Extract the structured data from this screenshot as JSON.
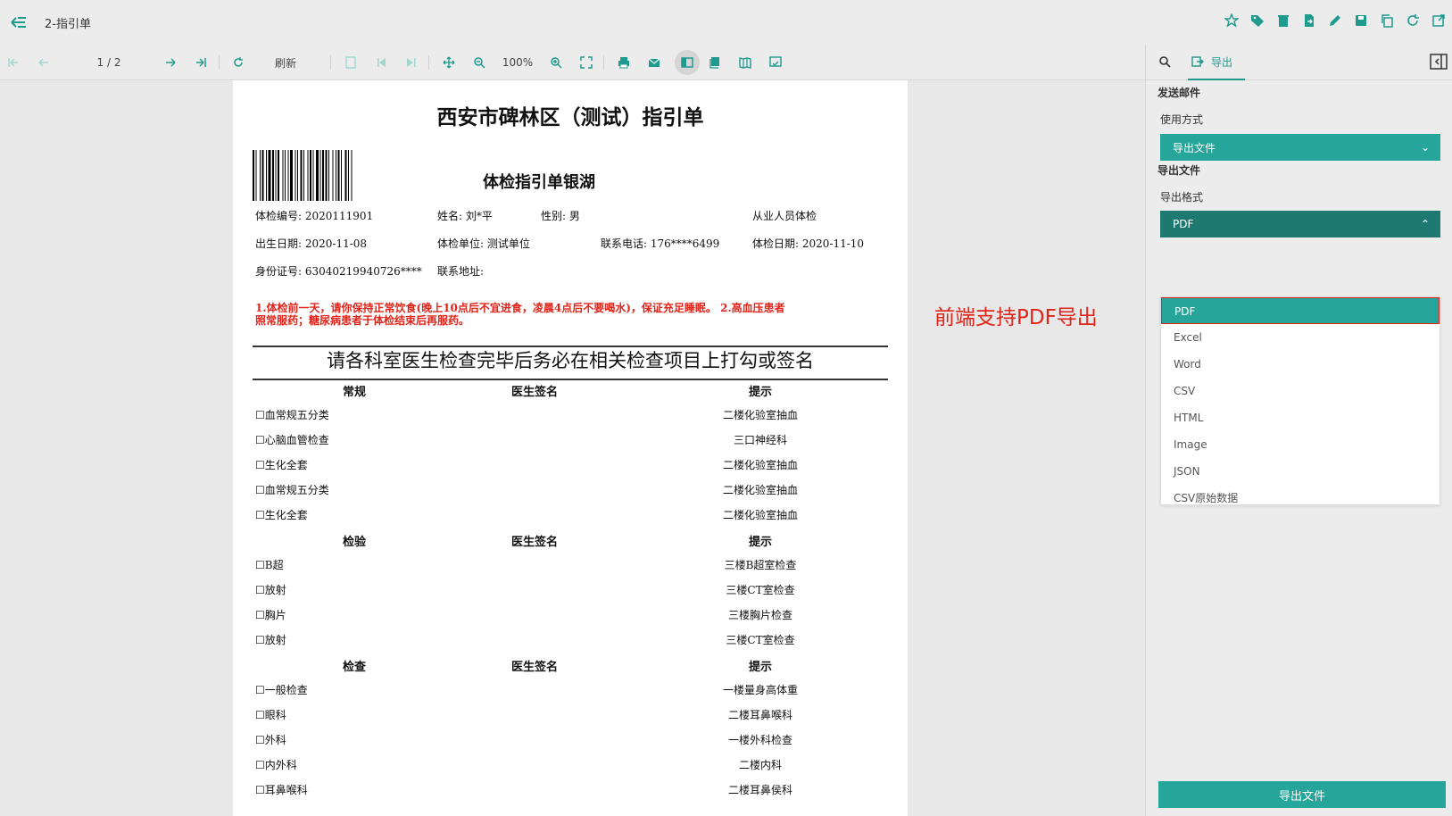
{
  "header": {
    "title": "2-指引单"
  },
  "toolbar": {
    "page_indicator": "1 / 2",
    "refresh_label": "刷新",
    "zoom_level": "100%"
  },
  "document": {
    "title": "西安市碑林区（测试）指引单",
    "subtitle": "体检指引单银湖",
    "info": {
      "exam_no": "体检编号: 2020111901",
      "name": "姓名: 刘*平",
      "gender": "性别: 男",
      "exam_type": "从业人员体检",
      "birth": "出生日期: 2020-11-08",
      "unit": "体检单位: 测试单位",
      "phone": "联系电话: 176****6499",
      "exam_date": "体检日期: 2020-11-10",
      "id_no": "身份证号: 63040219940726****",
      "address": "联系地址:"
    },
    "notice_line1": "1.体检前一天，请你保持正常饮食(晚上10点后不宜进食，凌晨4点后不要喝水)，保证充足睡眠。 2.高血压患者",
    "notice_line2": "照常服药；糖尿病患者于体检结束后再服药。",
    "banner": "请各科室医生检查完毕后务必在相关检查项目上打勾或签名",
    "sections": [
      {
        "headers": [
          "常规",
          "医生签名",
          "提示"
        ],
        "rows": [
          {
            "item": "☐血常规五分类",
            "hint": "二楼化验室抽血"
          },
          {
            "item": "☐心脑血管检查",
            "hint": "三口神经科"
          },
          {
            "item": "☐生化全套",
            "hint": "二楼化验室抽血"
          },
          {
            "item": "☐血常规五分类",
            "hint": "二楼化验室抽血"
          },
          {
            "item": "☐生化全套",
            "hint": "二楼化验室抽血"
          }
        ]
      },
      {
        "headers": [
          "检验",
          "医生签名",
          "提示"
        ],
        "rows": [
          {
            "item": "☐B超",
            "hint": "三楼B超室检查"
          },
          {
            "item": "☐放射",
            "hint": "三楼CT室检查"
          },
          {
            "item": "☐胸片",
            "hint": "三楼胸片检查"
          },
          {
            "item": "☐放射",
            "hint": "三楼CT室检查"
          }
        ]
      },
      {
        "headers": [
          "检查",
          "医生签名",
          "提示"
        ],
        "rows": [
          {
            "item": "☐一般检查",
            "hint": "一楼量身高体重"
          },
          {
            "item": "☐眼科",
            "hint": "二楼耳鼻喉科"
          },
          {
            "item": "☐外科",
            "hint": "一楼外科检查"
          },
          {
            "item": "☐内外科",
            "hint": "二楼内科"
          },
          {
            "item": "☐耳鼻喉科",
            "hint": "二楼耳鼻侯科"
          }
        ]
      }
    ]
  },
  "annotation": "前端支持PDF导出",
  "panel": {
    "tab_export": "导出",
    "send_email": "发送邮件",
    "usage_label": "使用方式",
    "usage_value": "导出文件",
    "export_file_heading": "导出文件",
    "format_label": "导出格式",
    "format_value": "PDF",
    "format_options": [
      "PDF",
      "Excel",
      "Word",
      "CSV",
      "HTML",
      "Image",
      "JSON",
      "CSV原始数据"
    ],
    "export_button": "导出文件"
  },
  "colors": {
    "accent": "#26a69a",
    "accent_dark": "#1e7a71",
    "alert": "#e0241a"
  }
}
